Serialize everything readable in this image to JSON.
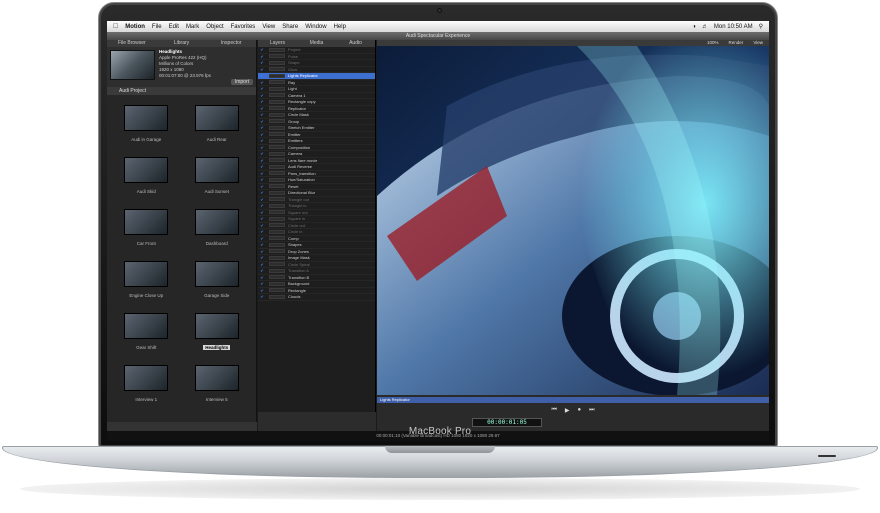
{
  "device": {
    "model_label": "MacBook Pro"
  },
  "menu_bar": {
    "items": [
      "Motion",
      "File",
      "Edit",
      "Mark",
      "Object",
      "Favorites",
      "View",
      "Share",
      "Window",
      "Help"
    ],
    "clock": "Mon 10:50 AM"
  },
  "window": {
    "title": "Audi Spectacular Experience"
  },
  "file_browser": {
    "tabs": [
      "File Browser",
      "Library",
      "Inspector"
    ],
    "preview": {
      "name": "Headlights",
      "codec": "Apple ProRes 422 (HQ)",
      "colors": "Millions of Colors",
      "size": "1920 x 1080",
      "duration": "00:01:07:00 @ 23.976 fps",
      "import_label": "Import"
    },
    "project_label": "Audi Project",
    "clips": [
      {
        "label": "Audi in Garage",
        "selected": false
      },
      {
        "label": "Audi Rear",
        "selected": false
      },
      {
        "label": "Audi Skid",
        "selected": false
      },
      {
        "label": "Audi Sunset",
        "selected": false
      },
      {
        "label": "Car Front",
        "selected": false
      },
      {
        "label": "Dashboard",
        "selected": false
      },
      {
        "label": "Engine Close Up",
        "selected": false
      },
      {
        "label": "Garage Side",
        "selected": false
      },
      {
        "label": "Gear Shift",
        "selected": false
      },
      {
        "label": "Headlights",
        "selected": true
      },
      {
        "label": "Interview 1",
        "selected": false
      },
      {
        "label": "Interview 5",
        "selected": false
      }
    ]
  },
  "layers_panel": {
    "tabs": [
      "Layers",
      "Media",
      "Audio"
    ],
    "rows": [
      {
        "name": "Project",
        "state": "dim"
      },
      {
        "name": "Pulse",
        "state": "dim"
      },
      {
        "name": "Shape",
        "state": "dim"
      },
      {
        "name": "Glow",
        "state": "dim"
      },
      {
        "name": "Lights Replicator",
        "state": "hl"
      },
      {
        "name": "Ray",
        "state": ""
      },
      {
        "name": "Light",
        "state": ""
      },
      {
        "name": "Camera 1",
        "state": ""
      },
      {
        "name": "Rectangle copy",
        "state": ""
      },
      {
        "name": "Replicator",
        "state": ""
      },
      {
        "name": "Circle Mask",
        "state": ""
      },
      {
        "name": "Group",
        "state": ""
      },
      {
        "name": "Stretch Emitter",
        "state": ""
      },
      {
        "name": "Emitter",
        "state": ""
      },
      {
        "name": "Emitters",
        "state": ""
      },
      {
        "name": "Composition",
        "state": ""
      },
      {
        "name": "Camera",
        "state": ""
      },
      {
        "name": "Lens flare movie",
        "state": ""
      },
      {
        "name": "Audi Reverse",
        "state": ""
      },
      {
        "name": "Pans_transition",
        "state": ""
      },
      {
        "name": "Hue/Saturation",
        "state": ""
      },
      {
        "name": "Reset",
        "state": ""
      },
      {
        "name": "Directional Blur",
        "state": ""
      },
      {
        "name": "Triangle out",
        "state": "dim"
      },
      {
        "name": "Triangle in",
        "state": "dim"
      },
      {
        "name": "Square out",
        "state": "dim"
      },
      {
        "name": "Square in",
        "state": "dim"
      },
      {
        "name": "Circle out",
        "state": "dim"
      },
      {
        "name": "Circle in",
        "state": "dim"
      },
      {
        "name": "Comp",
        "state": ""
      },
      {
        "name": "Shapes",
        "state": ""
      },
      {
        "name": "Drop Zones",
        "state": ""
      },
      {
        "name": "Image Mask",
        "state": ""
      },
      {
        "name": "Circle Spiral",
        "state": "dim"
      },
      {
        "name": "Transition A",
        "state": "dim"
      },
      {
        "name": "Transition B",
        "state": ""
      },
      {
        "name": "Background",
        "state": ""
      },
      {
        "name": "Rectangle",
        "state": ""
      },
      {
        "name": "Clouds",
        "state": ""
      }
    ]
  },
  "canvas": {
    "zoom": "100%",
    "render_label": "Render",
    "view_label": "View"
  },
  "timeline": {
    "track_label": "Lights Replicator",
    "timecode": "00:00:01:05"
  },
  "status_bar": {
    "text": "00:00:01:10 (Variable Broadcast) HD 1080 1920 x 1080 29.97"
  }
}
